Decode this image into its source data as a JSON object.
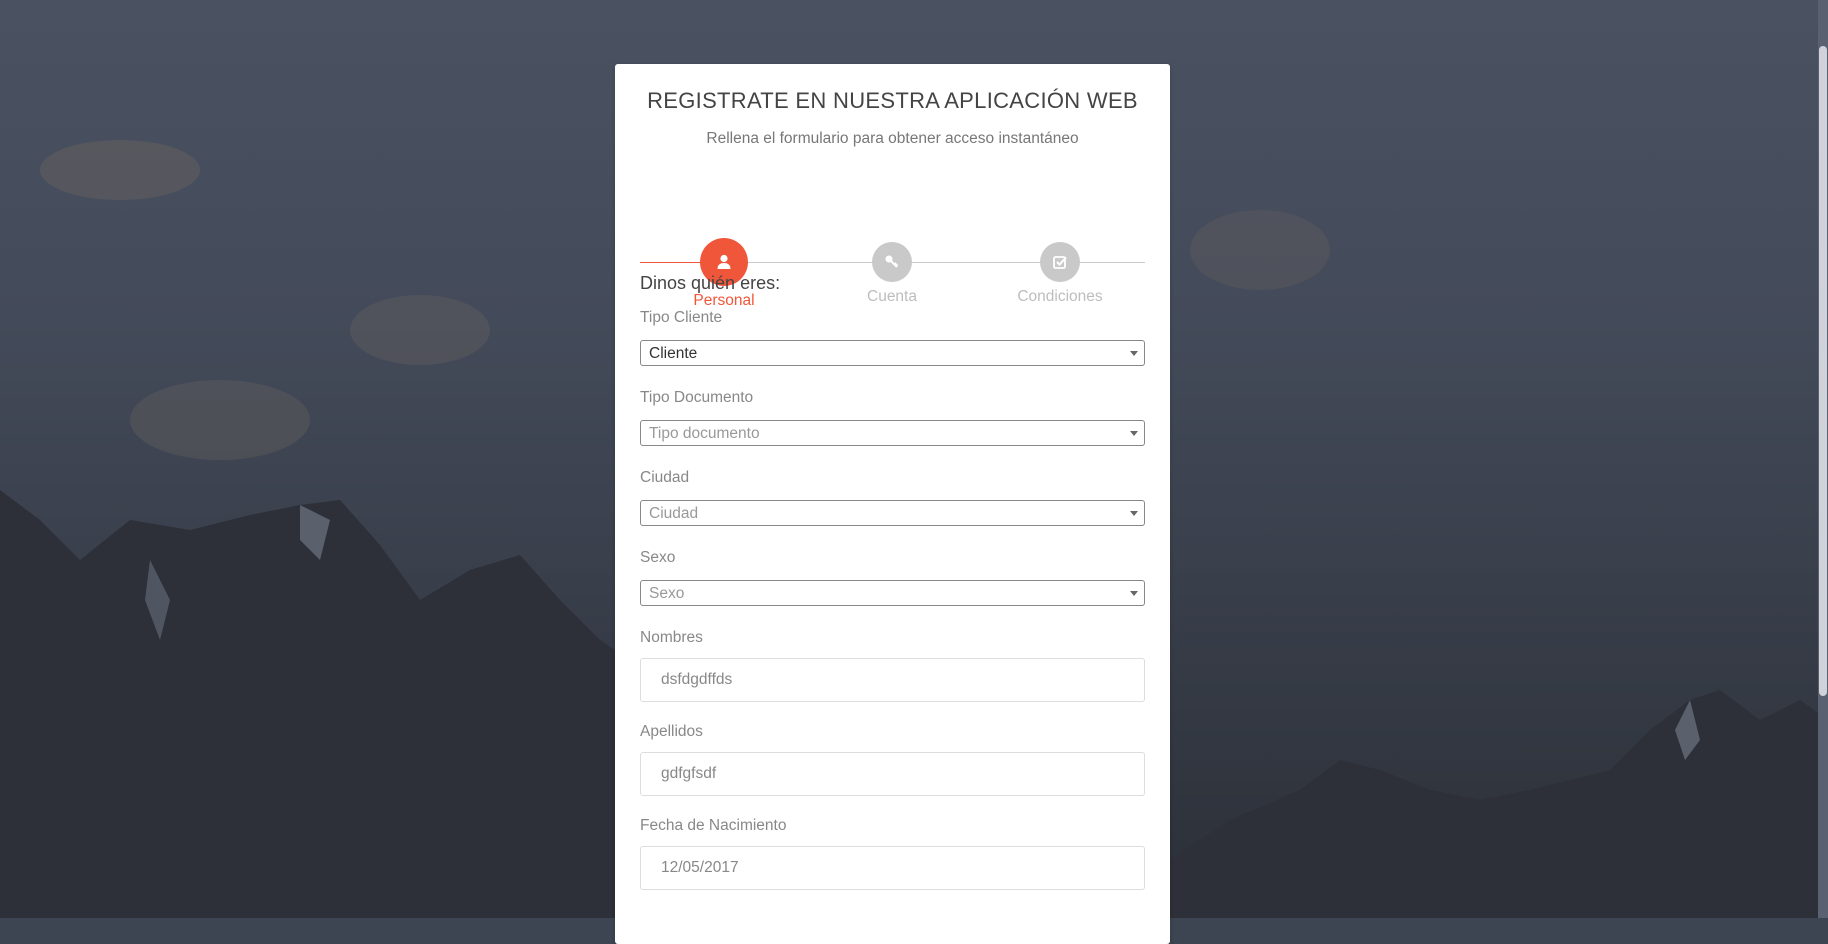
{
  "header": {
    "title": "REGISTRATE EN NUESTRA APLICACIÓN WEB",
    "subtitle": "Rellena el formulario para obtener acceso instantáneo"
  },
  "wizard": {
    "steps": [
      {
        "label": "Personal",
        "icon": "user-icon",
        "state": "active"
      },
      {
        "label": "Cuenta",
        "icon": "key-icon",
        "state": "inactive"
      },
      {
        "label": "Condiciones",
        "icon": "check-square-icon",
        "state": "inactive"
      }
    ],
    "accent_color": "#f0573a",
    "inactive_color": "#c9c9c9"
  },
  "form": {
    "section_title": "Dinos quién eres:",
    "tipo_cliente": {
      "label": "Tipo Cliente",
      "value": "Cliente"
    },
    "tipo_documento": {
      "label": "Tipo Documento",
      "placeholder": "Tipo documento"
    },
    "ciudad": {
      "label": "Ciudad",
      "placeholder": "Ciudad"
    },
    "sexo": {
      "label": "Sexo",
      "placeholder": "Sexo"
    },
    "nombres": {
      "label": "Nombres",
      "value": "dsfdgdffds"
    },
    "apellidos": {
      "label": "Apellidos",
      "value": "gdfgfsdf"
    },
    "fecha_nacimiento": {
      "label": "Fecha de Nacimiento",
      "value": "12/05/2017"
    }
  }
}
